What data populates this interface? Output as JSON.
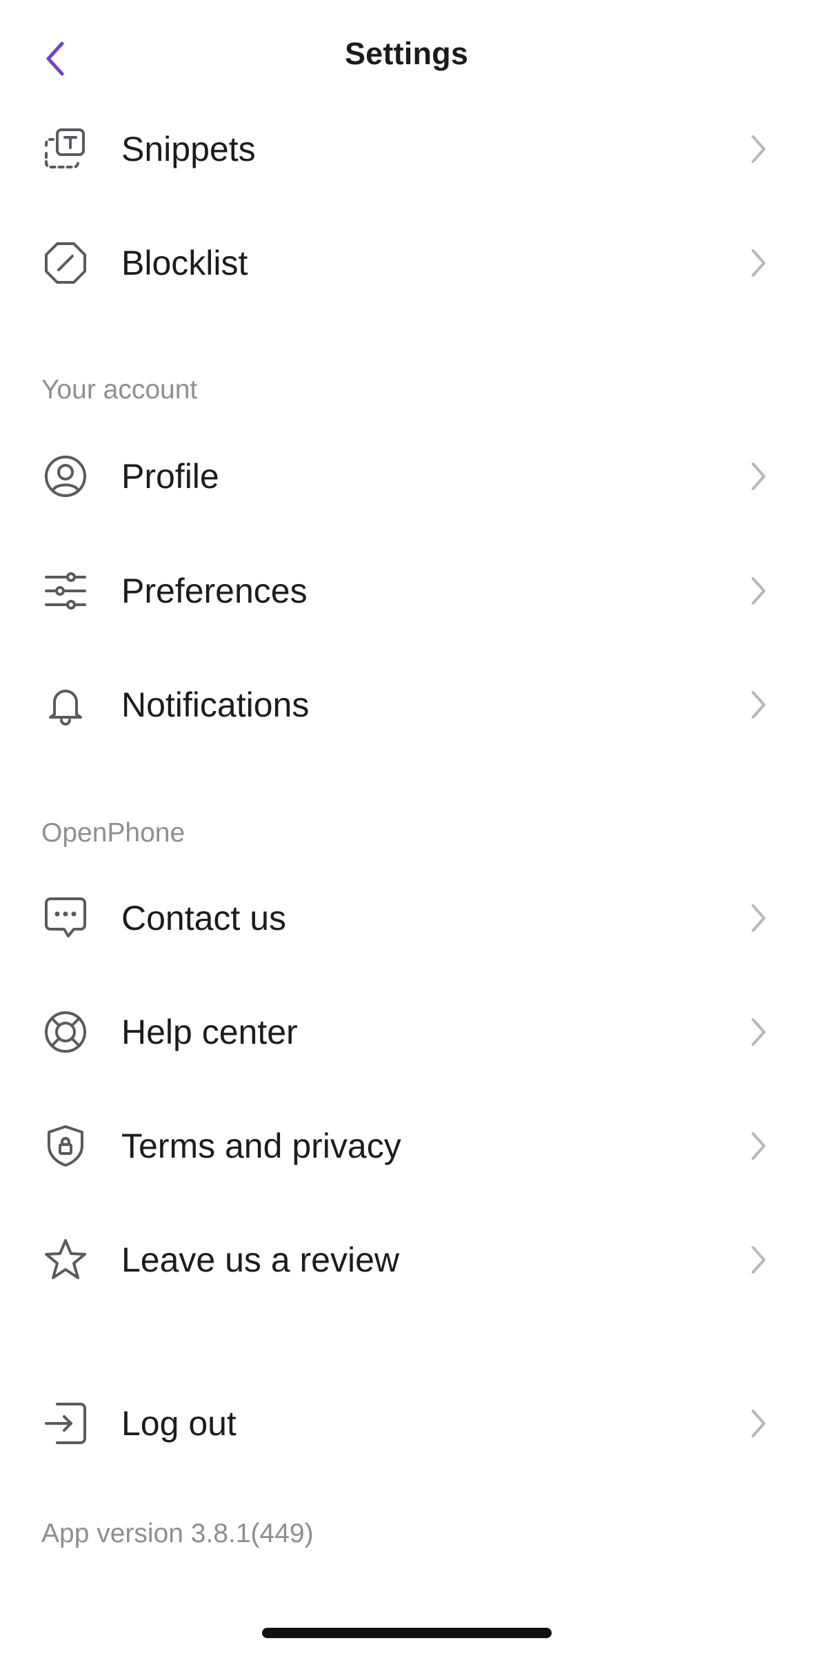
{
  "nav": {
    "title": "Settings",
    "back_icon": "chevron-left-icon",
    "accent_color": "#6e3fd6"
  },
  "groups": [
    {
      "header": "",
      "items": [
        {
          "label": "Snippets",
          "icon": "snippets-icon"
        },
        {
          "label": "Blocklist",
          "icon": "blocklist-icon"
        }
      ]
    },
    {
      "header": "Your account",
      "items": [
        {
          "label": "Profile",
          "icon": "profile-icon"
        },
        {
          "label": "Preferences",
          "icon": "sliders-icon"
        },
        {
          "label": "Notifications",
          "icon": "bell-icon"
        }
      ]
    },
    {
      "header": "OpenPhone",
      "items": [
        {
          "label": "Contact us",
          "icon": "chat-icon"
        },
        {
          "label": "Help center",
          "icon": "lifebuoy-icon"
        },
        {
          "label": "Terms and privacy",
          "icon": "shield-lock-icon"
        },
        {
          "label": "Leave us a review",
          "icon": "star-icon"
        }
      ]
    },
    {
      "header": "",
      "items": [
        {
          "label": "Log out",
          "icon": "logout-icon"
        }
      ]
    }
  ],
  "footer": {
    "app_version": "App version 3.8.1(449)"
  },
  "colors": {
    "icon": "#5a5a5e",
    "chevron": "#b8b8bc",
    "secondary_text": "#8e8e93"
  }
}
